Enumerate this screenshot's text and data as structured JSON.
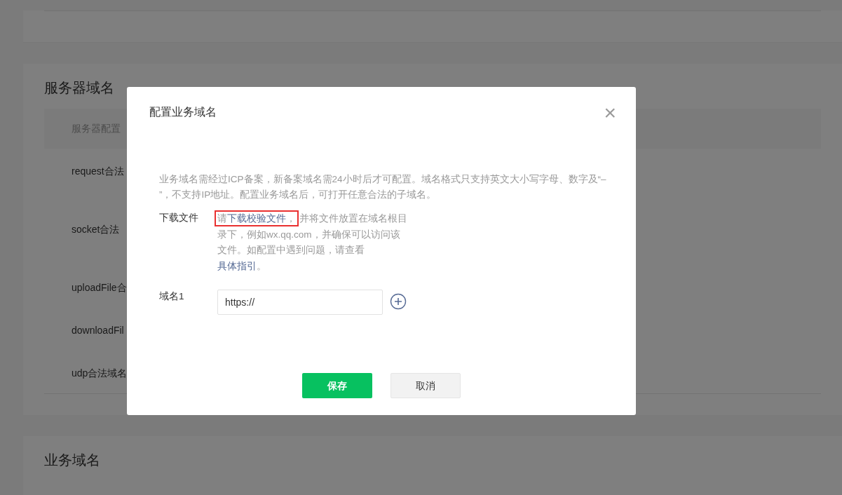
{
  "page": {
    "sections": [
      {
        "title": "服务器域名",
        "table": {
          "header": "服务器配置",
          "rows": [
            "request合法",
            "socket合法",
            "uploadFile合",
            "downloadFil",
            "udp合法域名"
          ]
        }
      },
      {
        "title": "业务域名"
      }
    ]
  },
  "dialog": {
    "title": "配置业务域名",
    "close": "×",
    "description": "业务域名需经过ICP备案，新备案域名需24小时后才可配置。域名格式只支持英文大小写字母、数字及“– ”，不支持IP地址。配置业务域名后，可打开任意合法的子域名。",
    "download": {
      "label": "下载文件",
      "segments": [
        {
          "kind": "text",
          "text": "请",
          "highlighted": true
        },
        {
          "kind": "link",
          "text": "下载校验文件",
          "highlighted": true
        },
        {
          "kind": "text",
          "text": "，",
          "highlighted": true
        },
        {
          "kind": "text",
          "text": "并将文件放置在域名根目录下，例如wx.qq.com，并确保可以访问该文件。如配置中遇到问题，请查看",
          "highlighted": false
        },
        {
          "kind": "link",
          "text": "具体指引",
          "highlighted": false
        },
        {
          "kind": "text",
          "text": "。",
          "highlighted": false
        }
      ]
    },
    "domains": [
      {
        "label": "域名1",
        "value": "https://"
      }
    ],
    "buttons": [
      {
        "kind": "primary",
        "label": "保存"
      },
      {
        "kind": "secondary",
        "label": "取消"
      }
    ]
  }
}
